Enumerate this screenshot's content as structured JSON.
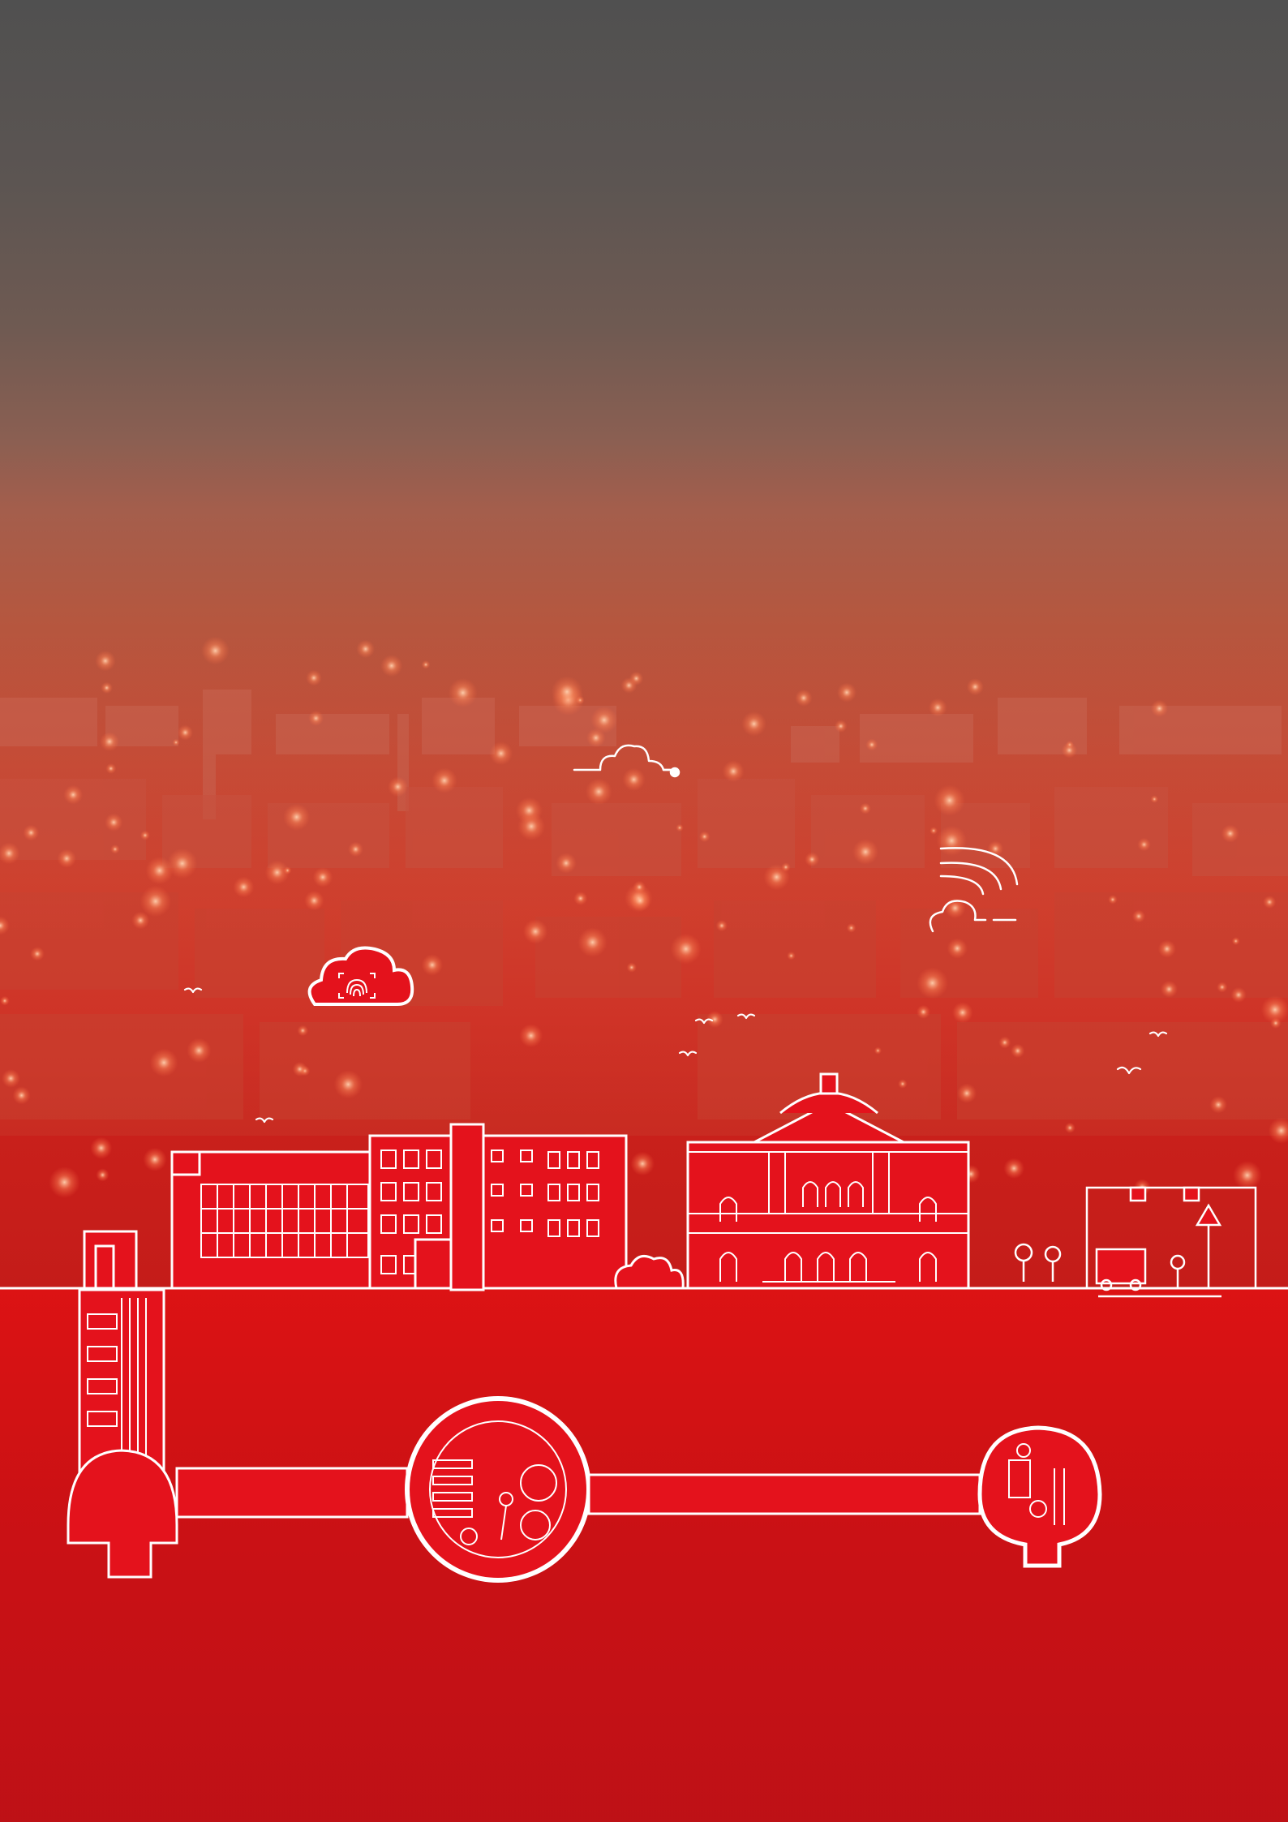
{
  "scene": {
    "description_colors": {
      "sky_top": "#505050",
      "haze": "#a45e4c",
      "city_red": "#d23b2a",
      "ground_red": "#e3101a",
      "line_white": "#ffffff"
    },
    "icons": [
      "cloud-connection-icon",
      "wifi-cloud-icon",
      "fingerprint-cloud-icon",
      "bird-icon"
    ]
  }
}
